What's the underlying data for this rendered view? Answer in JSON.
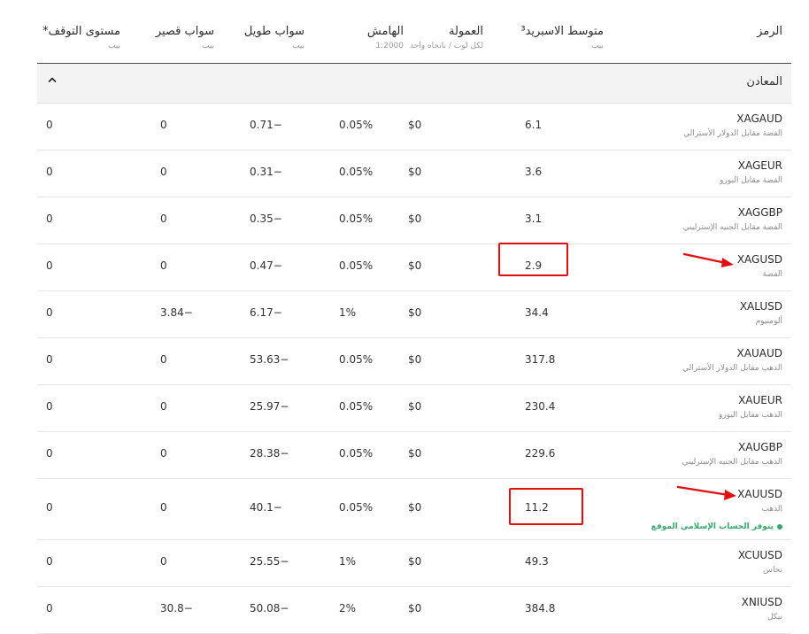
{
  "header": {
    "symbol": {
      "title": "الرمز",
      "sub": ""
    },
    "spread": {
      "title": "متوسط الاسبريد³",
      "sub": "بيب"
    },
    "commission": {
      "title": "العمولة",
      "sub": "لكل لوت / باتجاه واحد"
    },
    "margin": {
      "title": "الهامش",
      "sub": "1:2000"
    },
    "swap_long": {
      "title": "سواب طويل",
      "sub": "بيب"
    },
    "swap_short": {
      "title": "سواب قصير",
      "sub": "بيب"
    },
    "stop_level": {
      "title": "مستوى التوقف*",
      "sub": "بيب"
    }
  },
  "section": {
    "title": "المعادن",
    "caret_icon": "chevron-up-icon"
  },
  "rows": [
    {
      "code": "XAGAUD",
      "name": "الفضة مقابل الدولار الأسترالي",
      "spread": "6.1",
      "commission": "$0",
      "margin": "0.05%",
      "swap_long": "0.71−",
      "swap_short": "0",
      "stop": "0"
    },
    {
      "code": "XAGEUR",
      "name": "الفضة مقابل اليورو",
      "spread": "3.6",
      "commission": "$0",
      "margin": "0.05%",
      "swap_long": "0.31−",
      "swap_short": "0",
      "stop": "0"
    },
    {
      "code": "XAGGBP",
      "name": "الفضة مقابل الجنيه الإسترليني",
      "spread": "3.1",
      "commission": "$0",
      "margin": "0.05%",
      "swap_long": "0.35−",
      "swap_short": "0",
      "stop": "0"
    },
    {
      "code": "XAGUSD",
      "name": "الفضة",
      "spread": "2.9",
      "commission": "$0",
      "margin": "0.05%",
      "swap_long": "0.47−",
      "swap_short": "0",
      "stop": "0"
    },
    {
      "code": "XALUSD",
      "name": "ألومنيوم",
      "spread": "34.4",
      "commission": "$0",
      "margin": "1%",
      "swap_long": "6.17−",
      "swap_short": "3.84−",
      "stop": "0"
    },
    {
      "code": "XAUAUD",
      "name": "الذهب مقابل الدولار الأسترالي",
      "spread": "317.8",
      "commission": "$0",
      "margin": "0.05%",
      "swap_long": "53.63−",
      "swap_short": "0",
      "stop": "0"
    },
    {
      "code": "XAUEUR",
      "name": "الذهب مقابل اليورو",
      "spread": "230.4",
      "commission": "$0",
      "margin": "0.05%",
      "swap_long": "25.97−",
      "swap_short": "0",
      "stop": "0"
    },
    {
      "code": "XAUGBP",
      "name": "الذهب مقابل الجنيه الإسترليني",
      "spread": "229.6",
      "commission": "$0",
      "margin": "0.05%",
      "swap_long": "28.38−",
      "swap_short": "0",
      "stop": "0"
    },
    {
      "code": "XAUUSD",
      "name": "الذهب",
      "note": "يتوفر الحساب الإسلامي الموقع",
      "spread": "11.2",
      "commission": "$0",
      "margin": "0.05%",
      "swap_long": "40.1−",
      "swap_short": "0",
      "stop": "0"
    },
    {
      "code": "XCUUSD",
      "name": "نحاس",
      "spread": "49.3",
      "commission": "$0",
      "margin": "1%",
      "swap_long": "25.55−",
      "swap_short": "0",
      "stop": "0"
    },
    {
      "code": "XNIUSD",
      "name": "نيكل",
      "spread": "384.8",
      "commission": "$0",
      "margin": "2%",
      "swap_long": "50.08−",
      "swap_short": "30.8−",
      "stop": "0"
    }
  ],
  "annotation": {
    "color": "#e01010"
  }
}
